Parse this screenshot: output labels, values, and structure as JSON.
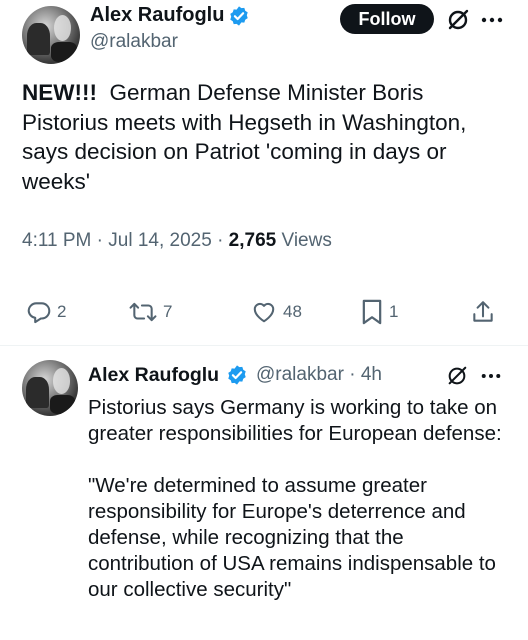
{
  "main_tweet": {
    "author": {
      "name": "Alex Raufoglu",
      "handle": "@ralakbar"
    },
    "follow_label": "Follow",
    "text_prefix": "NEW!!!",
    "text_body": "German Defense Minister Boris Pistorius meets with Hegseth in Washington, says decision on Patriot 'coming in days or weeks'",
    "time": "4:11 PM",
    "date": "Jul 14, 2025",
    "views_count": "2,765",
    "views_label": "Views",
    "stats": {
      "replies": "2",
      "retweets": "7",
      "likes": "48",
      "bookmarks": "1"
    }
  },
  "reply_tweet": {
    "author": {
      "name": "Alex Raufoglu",
      "handle": "@ralakbar"
    },
    "time_ago": "4h",
    "paragraph1": "Pistorius says Germany is working to take on greater responsibilities for European defense:",
    "paragraph2": "\"We're determined to assume greater responsibility for Europe's deterrence and defense, while recognizing that the contribution of USA remains indispensable to our collective security\""
  },
  "icons": [
    "verified-badge-icon",
    "grok-icon",
    "more-icon",
    "reply-icon",
    "retweet-icon",
    "like-icon",
    "bookmark-icon",
    "share-icon"
  ],
  "colors": {
    "verified": "#1d9bf0",
    "text": "#0f1419",
    "secondary": "#536471",
    "follow_bg": "#0f1419"
  }
}
